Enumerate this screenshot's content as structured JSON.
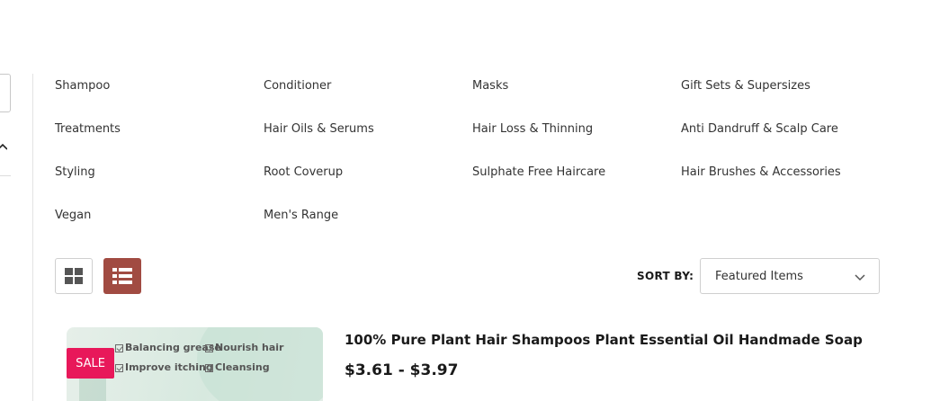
{
  "categories": [
    "Shampoo",
    "Conditioner",
    "Masks",
    "Gift Sets & Supersizes",
    "Treatments",
    "Hair Oils & Serums",
    "Hair Loss & Thinning",
    "Anti Dandruff & Scalp Care",
    "Styling",
    "Root Coverup",
    "Sulphate Free Haircare",
    "Hair Brushes & Accessories",
    "Vegan",
    "Men's Range"
  ],
  "view_toggle": {
    "grid_icon": "grid-view-icon",
    "list_icon": "list-view-icon",
    "active": "list",
    "active_color": "#a14b42"
  },
  "sort": {
    "label": "SORT BY:",
    "selected": "Featured Items",
    "icon": "chevron-down-icon"
  },
  "product": {
    "image_features": [
      "Balancing grease",
      "Nourish hair",
      "Improve itching",
      "Cleansing"
    ],
    "badge": "SALE",
    "badge_color": "#e8185a",
    "title": "100% Pure Plant Hair Shampoos Plant Essential Oil Handmade Soap",
    "price": "$3.61 - $3.97"
  }
}
